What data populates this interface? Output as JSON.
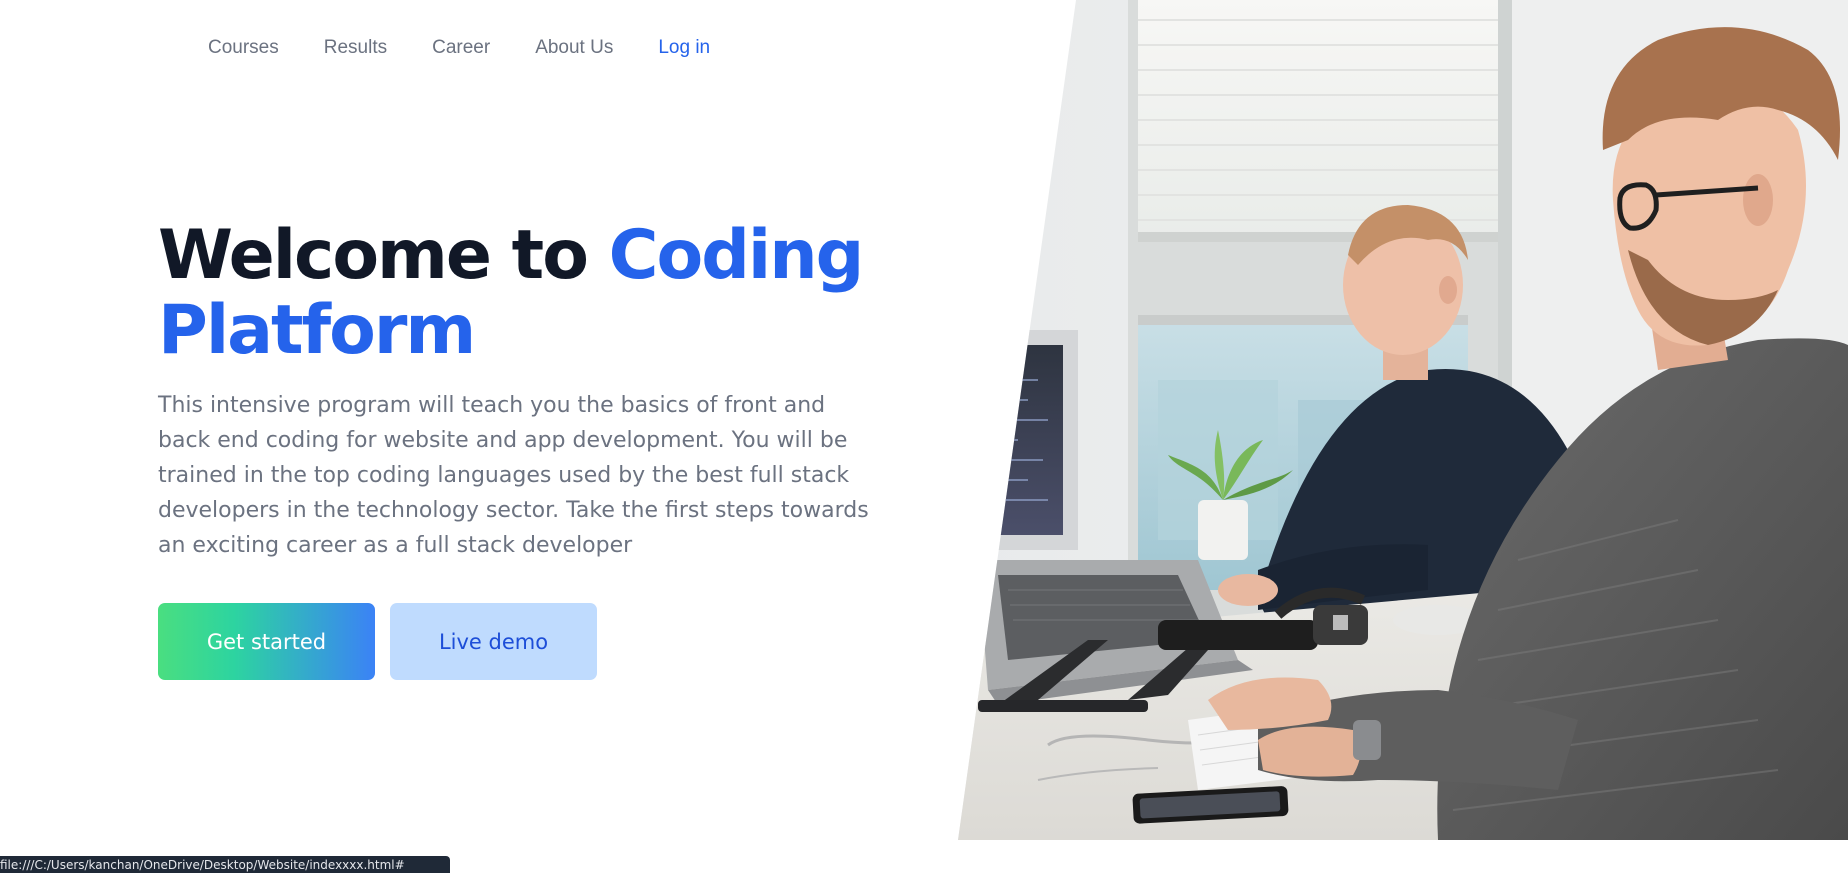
{
  "nav": {
    "items": [
      {
        "label": "Courses"
      },
      {
        "label": "Results"
      },
      {
        "label": "Career"
      },
      {
        "label": "About Us"
      }
    ],
    "login_label": "Log in"
  },
  "hero": {
    "title_part1": "Welcome to ",
    "title_part2": "Coding Platform",
    "description": "This intensive program will teach you the basics of front and back end coding for website and app development. You will be trained in the top coding languages used by the best full stack developers in the technology sector. Take the first steps towards an exciting career as a full stack developer",
    "primary_button": "Get started",
    "secondary_button": "Live demo"
  },
  "image": {
    "alt_icon": "office-developers-photo"
  },
  "statusbar": {
    "url": "file:///C:/Users/kanchan/OneDrive/Desktop/Website/indexxxx.html#"
  },
  "colors": {
    "accent": "#2563eb",
    "title": "#111827",
    "muted": "#6b7280",
    "secondary_button_bg": "#bfdbfe"
  }
}
